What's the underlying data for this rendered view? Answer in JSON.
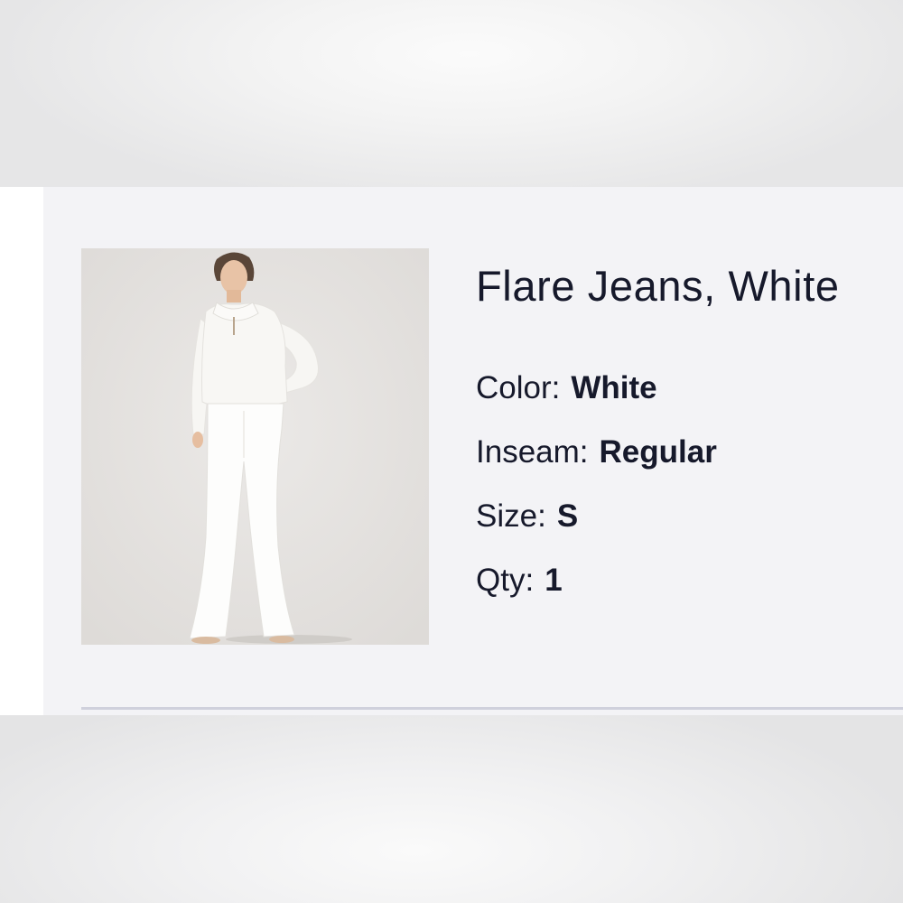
{
  "product": {
    "title": "Flare Jeans, White",
    "image_icon": "product-photo",
    "attributes": {
      "color": {
        "label": "Color:",
        "value": "White"
      },
      "inseam": {
        "label": "Inseam:",
        "value": "Regular"
      },
      "size": {
        "label": "Size:",
        "value": "S"
      },
      "qty": {
        "label": "Qty:",
        "value": "1"
      }
    }
  },
  "colors": {
    "text": "#16192b",
    "card_background": "#f3f3f6",
    "divider": "#cfd0dc"
  }
}
